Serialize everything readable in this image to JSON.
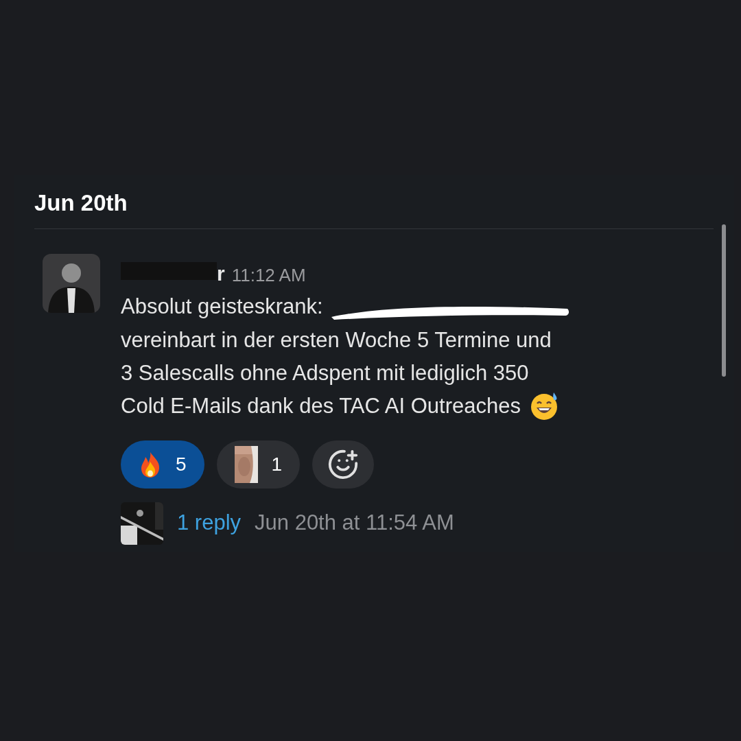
{
  "date_divider": "Jun 20th",
  "message": {
    "author_visible": "r",
    "author_redacted": true,
    "time": "11:12 AM",
    "text_start": "Absolut geisteskrank:",
    "text_redacted": true,
    "text_lines": [
      "vereinbart in der ersten Woche 5 Termine und",
      "3 Salescalls ohne Adspent mit lediglich 350",
      "Cold E-Mails dank des TAC AI Outreaches"
    ]
  },
  "reactions": [
    {
      "kind": "fire",
      "count": "5",
      "selected": true
    },
    {
      "kind": "picture",
      "count": "1",
      "selected": false
    }
  ],
  "thread": {
    "replies": "1 reply",
    "last_reply": "Jun 20th at 11:54 AM"
  }
}
